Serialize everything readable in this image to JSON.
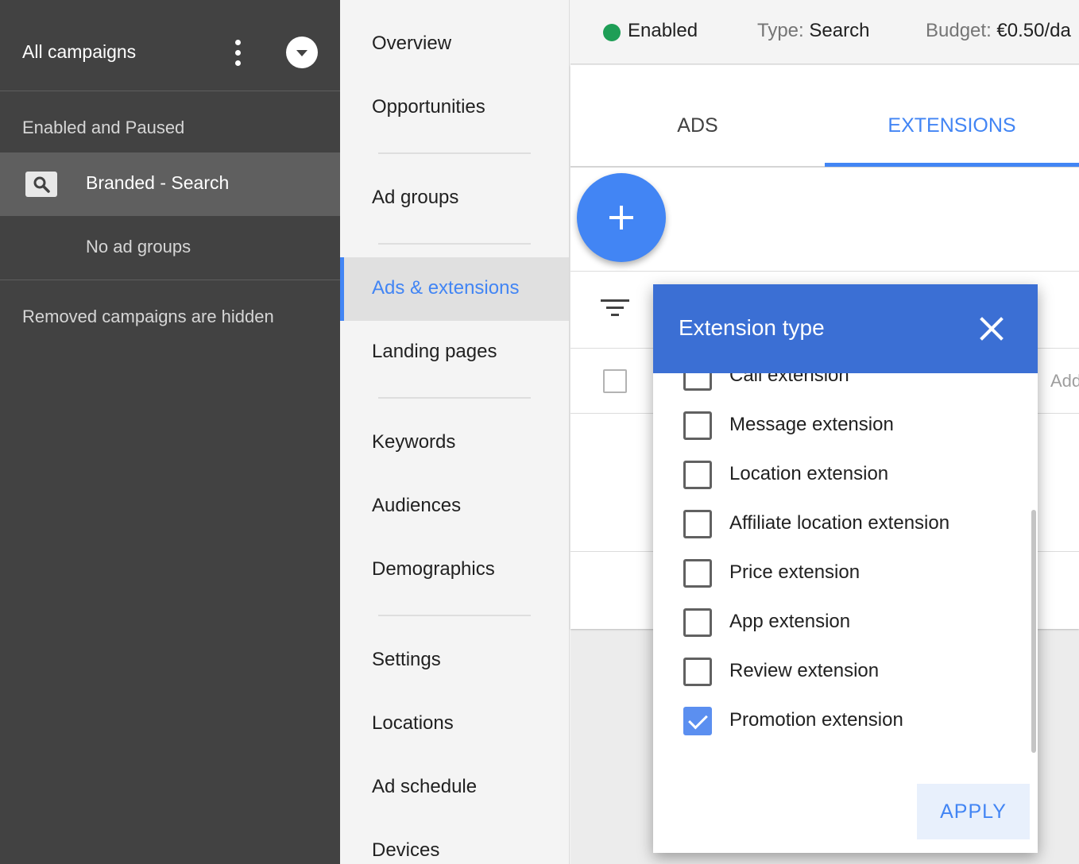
{
  "sidebar": {
    "title": "All campaigns",
    "section_label": "Enabled and Paused",
    "selected_campaign": "Branded - Search",
    "no_ad_groups": "No ad groups",
    "removed_note": "Removed campaigns are hidden"
  },
  "nav": {
    "items": [
      "Overview",
      "Opportunities",
      "Ad groups",
      "Ads & extensions",
      "Landing pages",
      "Keywords",
      "Audiences",
      "Demographics",
      "Settings",
      "Locations",
      "Ad schedule",
      "Devices"
    ],
    "active": "Ads & extensions"
  },
  "status": {
    "state": "Enabled",
    "type_label": "Type:",
    "type_value": "Search",
    "budget_label": "Budget:",
    "budget_value": "€0.50/da"
  },
  "tabs": [
    "ADS",
    "EXTENSIONS"
  ],
  "active_tab": "EXTENSIONS",
  "table": {
    "add_text": "Add"
  },
  "dialog": {
    "title": "Extension type",
    "options": [
      {
        "label": "Call extension",
        "checked": false
      },
      {
        "label": "Message extension",
        "checked": false
      },
      {
        "label": "Location extension",
        "checked": false
      },
      {
        "label": "Affiliate location extension",
        "checked": false
      },
      {
        "label": "Price extension",
        "checked": false
      },
      {
        "label": "App extension",
        "checked": false
      },
      {
        "label": "Review extension",
        "checked": false
      },
      {
        "label": "Promotion extension",
        "checked": true
      }
    ],
    "apply_label": "APPLY"
  },
  "colors": {
    "accent": "#4285f4",
    "dialog_header": "#3b6fd4",
    "enabled": "#1e9e56",
    "sidebar": "#424242"
  }
}
